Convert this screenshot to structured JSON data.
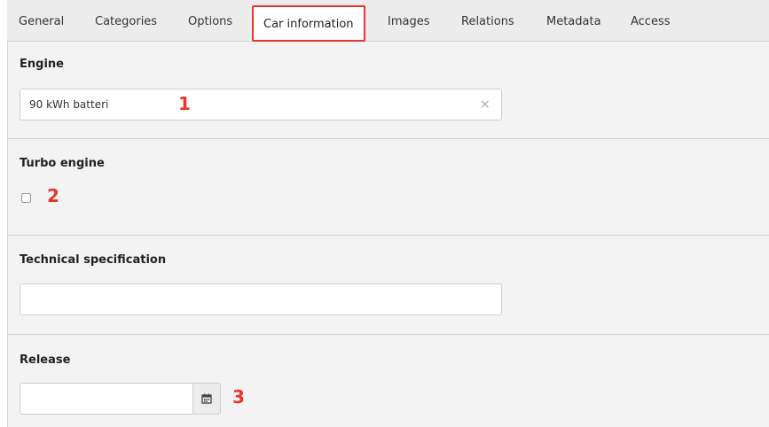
{
  "tabs": [
    {
      "label": "General"
    },
    {
      "label": "Categories"
    },
    {
      "label": "Options"
    },
    {
      "label": "Car information",
      "active": true
    },
    {
      "label": "Images"
    },
    {
      "label": "Relations"
    },
    {
      "label": "Metadata"
    },
    {
      "label": "Access"
    }
  ],
  "fields": {
    "engine": {
      "label": "Engine",
      "value": "90 kWh batteri",
      "clear_icon": "×"
    },
    "turbo": {
      "label": "Turbo engine",
      "checked": false
    },
    "tech_spec": {
      "label": "Technical specification",
      "value": ""
    },
    "release": {
      "label": "Release",
      "value": "",
      "icon": "calendar-icon"
    }
  },
  "annotations": [
    "1",
    "2",
    "3"
  ],
  "colors": {
    "highlight": "#e8352d",
    "panel_bg": "#f3f3f3",
    "tab_bg": "#ececec"
  }
}
